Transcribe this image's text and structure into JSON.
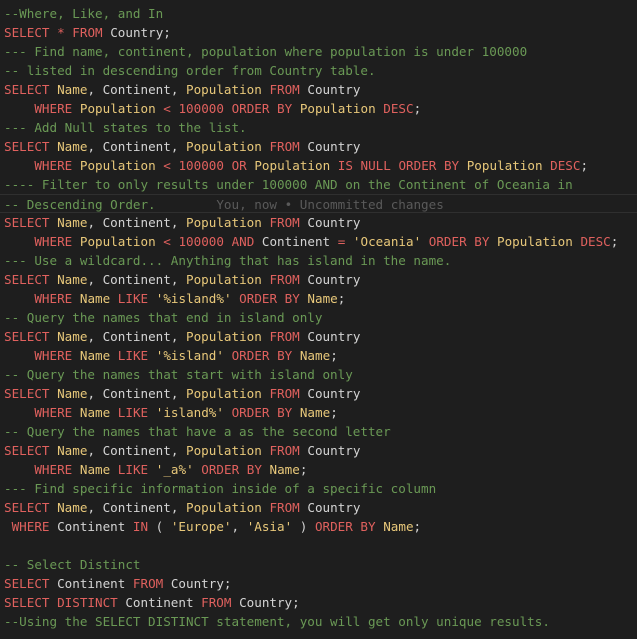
{
  "editor": {
    "blame": "You, now • Uncommitted changes",
    "lines": [
      [
        [
          "c",
          "--Where, Like, and In"
        ]
      ],
      [
        [
          "k",
          "SELECT"
        ],
        [
          "t",
          " "
        ],
        [
          "k",
          "*"
        ],
        [
          "t",
          " "
        ],
        [
          "k",
          "FROM"
        ],
        [
          "t",
          " Country;"
        ]
      ],
      [
        [
          "c",
          "--- Find name, continent, population where population is under 100000"
        ]
      ],
      [
        [
          "c",
          "-- listed in descending order from Country table."
        ]
      ],
      [
        [
          "k",
          "SELECT"
        ],
        [
          "t",
          " "
        ],
        [
          "f",
          "Name"
        ],
        [
          "t",
          ", Continent, "
        ],
        [
          "f",
          "Population"
        ],
        [
          "t",
          " "
        ],
        [
          "k",
          "FROM"
        ],
        [
          "t",
          " Country"
        ]
      ],
      [
        [
          "t",
          "    "
        ],
        [
          "k",
          "WHERE"
        ],
        [
          "t",
          " "
        ],
        [
          "f",
          "Population"
        ],
        [
          "t",
          " "
        ],
        [
          "k",
          "<"
        ],
        [
          "t",
          " "
        ],
        [
          "k",
          "100000"
        ],
        [
          "t",
          " "
        ],
        [
          "k",
          "ORDER BY"
        ],
        [
          "t",
          " "
        ],
        [
          "f",
          "Population"
        ],
        [
          "t",
          " "
        ],
        [
          "k",
          "DESC"
        ],
        [
          "t",
          ";"
        ]
      ],
      [
        [
          "c",
          "--- Add Null states to the list."
        ]
      ],
      [
        [
          "k",
          "SELECT"
        ],
        [
          "t",
          " "
        ],
        [
          "f",
          "Name"
        ],
        [
          "t",
          ", Continent, "
        ],
        [
          "f",
          "Population"
        ],
        [
          "t",
          " "
        ],
        [
          "k",
          "FROM"
        ],
        [
          "t",
          " Country"
        ]
      ],
      [
        [
          "t",
          "    "
        ],
        [
          "k",
          "WHERE"
        ],
        [
          "t",
          " "
        ],
        [
          "f",
          "Population"
        ],
        [
          "t",
          " "
        ],
        [
          "k",
          "<"
        ],
        [
          "t",
          " "
        ],
        [
          "k",
          "100000"
        ],
        [
          "t",
          " "
        ],
        [
          "k",
          "OR"
        ],
        [
          "t",
          " "
        ],
        [
          "f",
          "Population"
        ],
        [
          "t",
          " "
        ],
        [
          "k",
          "IS"
        ],
        [
          "t",
          " "
        ],
        [
          "k",
          "NULL"
        ],
        [
          "t",
          " "
        ],
        [
          "k",
          "ORDER BY"
        ],
        [
          "t",
          " "
        ],
        [
          "f",
          "Population"
        ],
        [
          "t",
          " "
        ],
        [
          "k",
          "DESC"
        ],
        [
          "t",
          ";"
        ]
      ],
      [
        [
          "c",
          "---- Filter to only results under 100000 AND on the Continent of Oceania in"
        ]
      ],
      [
        [
          "c",
          "-- Descending Order."
        ]
      ],
      [
        [
          "k",
          "SELECT"
        ],
        [
          "t",
          " "
        ],
        [
          "f",
          "Name"
        ],
        [
          "t",
          ", Continent, "
        ],
        [
          "f",
          "Population"
        ],
        [
          "t",
          " "
        ],
        [
          "k",
          "FROM"
        ],
        [
          "t",
          " Country"
        ]
      ],
      [
        [
          "t",
          "    "
        ],
        [
          "k",
          "WHERE"
        ],
        [
          "t",
          " "
        ],
        [
          "f",
          "Population"
        ],
        [
          "t",
          " "
        ],
        [
          "k",
          "<"
        ],
        [
          "t",
          " "
        ],
        [
          "k",
          "100000"
        ],
        [
          "t",
          " "
        ],
        [
          "k",
          "AND"
        ],
        [
          "t",
          " Continent "
        ],
        [
          "k",
          "="
        ],
        [
          "t",
          " "
        ],
        [
          "s",
          "'Oceania'"
        ],
        [
          "t",
          " "
        ],
        [
          "k",
          "ORDER BY"
        ],
        [
          "t",
          " "
        ],
        [
          "f",
          "Population"
        ],
        [
          "t",
          " "
        ],
        [
          "k",
          "DESC"
        ],
        [
          "t",
          ";"
        ]
      ],
      [
        [
          "c",
          "--- Use a wildcard... Anything that has island in the name."
        ]
      ],
      [
        [
          "k",
          "SELECT"
        ],
        [
          "t",
          " "
        ],
        [
          "f",
          "Name"
        ],
        [
          "t",
          ", Continent, "
        ],
        [
          "f",
          "Population"
        ],
        [
          "t",
          " "
        ],
        [
          "k",
          "FROM"
        ],
        [
          "t",
          " Country"
        ]
      ],
      [
        [
          "t",
          "    "
        ],
        [
          "k",
          "WHERE"
        ],
        [
          "t",
          " "
        ],
        [
          "f",
          "Name"
        ],
        [
          "t",
          " "
        ],
        [
          "k",
          "LIKE"
        ],
        [
          "t",
          " "
        ],
        [
          "s",
          "'%island%'"
        ],
        [
          "t",
          " "
        ],
        [
          "k",
          "ORDER BY"
        ],
        [
          "t",
          " "
        ],
        [
          "f",
          "Name"
        ],
        [
          "t",
          ";"
        ]
      ],
      [
        [
          "c",
          "-- Query the names that end in island only"
        ]
      ],
      [
        [
          "k",
          "SELECT"
        ],
        [
          "t",
          " "
        ],
        [
          "f",
          "Name"
        ],
        [
          "t",
          ", Continent, "
        ],
        [
          "f",
          "Population"
        ],
        [
          "t",
          " "
        ],
        [
          "k",
          "FROM"
        ],
        [
          "t",
          " Country"
        ]
      ],
      [
        [
          "t",
          "    "
        ],
        [
          "k",
          "WHERE"
        ],
        [
          "t",
          " "
        ],
        [
          "f",
          "Name"
        ],
        [
          "t",
          " "
        ],
        [
          "k",
          "LIKE"
        ],
        [
          "t",
          " "
        ],
        [
          "s",
          "'%island'"
        ],
        [
          "t",
          " "
        ],
        [
          "k",
          "ORDER BY"
        ],
        [
          "t",
          " "
        ],
        [
          "f",
          "Name"
        ],
        [
          "t",
          ";"
        ]
      ],
      [
        [
          "c",
          "-- Query the names that start with island only"
        ]
      ],
      [
        [
          "k",
          "SELECT"
        ],
        [
          "t",
          " "
        ],
        [
          "f",
          "Name"
        ],
        [
          "t",
          ", Continent, "
        ],
        [
          "f",
          "Population"
        ],
        [
          "t",
          " "
        ],
        [
          "k",
          "FROM"
        ],
        [
          "t",
          " Country"
        ]
      ],
      [
        [
          "t",
          "    "
        ],
        [
          "k",
          "WHERE"
        ],
        [
          "t",
          " "
        ],
        [
          "f",
          "Name"
        ],
        [
          "t",
          " "
        ],
        [
          "k",
          "LIKE"
        ],
        [
          "t",
          " "
        ],
        [
          "s",
          "'island%'"
        ],
        [
          "t",
          " "
        ],
        [
          "k",
          "ORDER BY"
        ],
        [
          "t",
          " "
        ],
        [
          "f",
          "Name"
        ],
        [
          "t",
          ";"
        ]
      ],
      [
        [
          "c",
          "-- Query the names that have a as the second letter"
        ]
      ],
      [
        [
          "k",
          "SELECT"
        ],
        [
          "t",
          " "
        ],
        [
          "f",
          "Name"
        ],
        [
          "t",
          ", Continent, "
        ],
        [
          "f",
          "Population"
        ],
        [
          "t",
          " "
        ],
        [
          "k",
          "FROM"
        ],
        [
          "t",
          " Country"
        ]
      ],
      [
        [
          "t",
          "    "
        ],
        [
          "k",
          "WHERE"
        ],
        [
          "t",
          " "
        ],
        [
          "f",
          "Name"
        ],
        [
          "t",
          " "
        ],
        [
          "k",
          "LIKE"
        ],
        [
          "t",
          " "
        ],
        [
          "s",
          "'_a%'"
        ],
        [
          "t",
          " "
        ],
        [
          "k",
          "ORDER BY"
        ],
        [
          "t",
          " "
        ],
        [
          "f",
          "Name"
        ],
        [
          "t",
          ";"
        ]
      ],
      [
        [
          "c",
          "--- Find specific information inside of a specific column"
        ]
      ],
      [
        [
          "k",
          "SELECT"
        ],
        [
          "t",
          " "
        ],
        [
          "f",
          "Name"
        ],
        [
          "t",
          ", Continent, "
        ],
        [
          "f",
          "Population"
        ],
        [
          "t",
          " "
        ],
        [
          "k",
          "FROM"
        ],
        [
          "t",
          " Country"
        ]
      ],
      [
        [
          "t",
          " "
        ],
        [
          "k",
          "WHERE"
        ],
        [
          "t",
          " Continent "
        ],
        [
          "k",
          "IN"
        ],
        [
          "t",
          " ( "
        ],
        [
          "s",
          "'Europe'"
        ],
        [
          "t",
          ", "
        ],
        [
          "s",
          "'Asia'"
        ],
        [
          "t",
          " ) "
        ],
        [
          "k",
          "ORDER BY"
        ],
        [
          "t",
          " "
        ],
        [
          "f",
          "Name"
        ],
        [
          "t",
          ";"
        ]
      ],
      [],
      [
        [
          "c",
          "-- Select Distinct"
        ]
      ],
      [
        [
          "k",
          "SELECT"
        ],
        [
          "t",
          " Continent "
        ],
        [
          "k",
          "FROM"
        ],
        [
          "t",
          " Country;"
        ]
      ],
      [
        [
          "k",
          "SELECT DISTINCT"
        ],
        [
          "t",
          " Continent "
        ],
        [
          "k",
          "FROM"
        ],
        [
          "t",
          " Country;"
        ]
      ],
      [
        [
          "c",
          "--Using the SELECT DISTINCT statement, you will get only unique results."
        ]
      ]
    ],
    "current_line": 10,
    "colors": {
      "background": "#1e1e1e",
      "comment": "#6a9955",
      "keyword": "#e0615e",
      "field": "#e8c87a",
      "string": "#e8c87a",
      "text": "#d4d4d4",
      "blame": "#5a5a5a"
    }
  }
}
